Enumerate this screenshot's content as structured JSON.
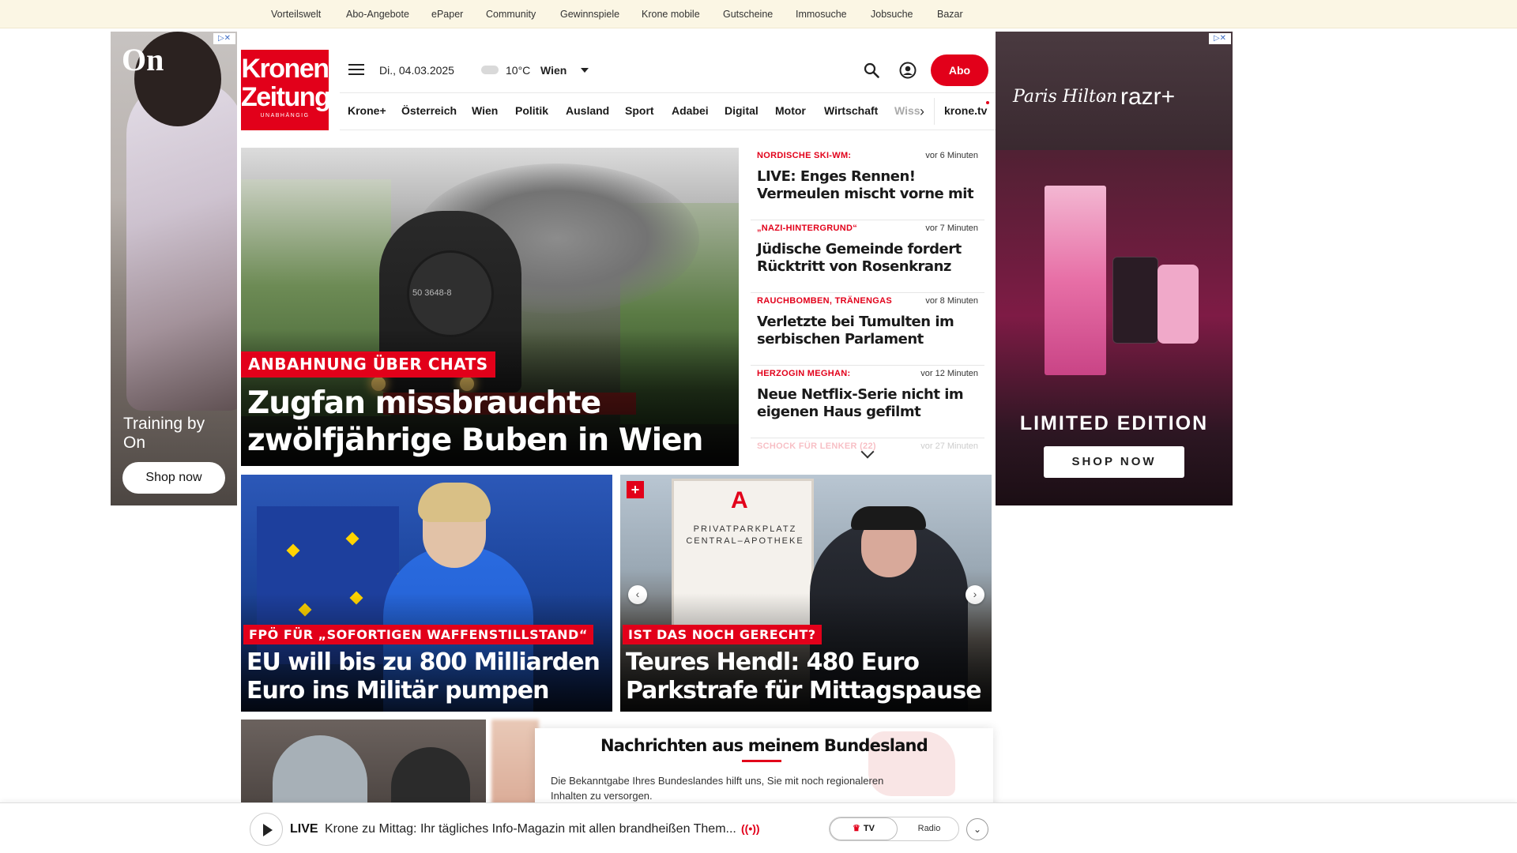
{
  "topbar": {
    "links": [
      "Vorteilswelt",
      "Abo-Angebote",
      "ePaper",
      "Community",
      "Gewinnspiele",
      "Krone mobile",
      "Gutscheine",
      "Immosuche",
      "Jobsuche",
      "Bazar"
    ]
  },
  "ads": {
    "left": {
      "brand": "On",
      "tagline": "Training by On",
      "cta": "Shop now",
      "adchoice": "▷✕"
    },
    "right": {
      "signature": "Paris Hilton",
      "x": "×",
      "brand": "razr+",
      "headline": "LIMITED EDITION",
      "cta": "SHOP NOW",
      "adchoice": "▷✕"
    }
  },
  "logo": {
    "line1": "Kronen",
    "line2": "Zeitung",
    "line3": "UNABHÄNGIG"
  },
  "header": {
    "date": "Di., 04.03.2025",
    "temperature": "10°C",
    "city": "Wien",
    "abo_label": "Abo"
  },
  "nav": {
    "items": [
      "Krone+",
      "Österreich",
      "Wien",
      "Politik",
      "Ausland",
      "Sport",
      "Adabei",
      "Digital",
      "Motor",
      "Wirtschaft",
      "Wiss"
    ],
    "tv_link": "krone.tv",
    "arrow": "›"
  },
  "hero": {
    "kicker": "ANBAHNUNG ÜBER CHATS",
    "headline": "Zugfan missbrauchte zwölfjährige Buben in Wien",
    "loco_number": "50 3648-8"
  },
  "ticker": [
    {
      "tag": "NORDISCHE SKI-WM:",
      "time": "vor 6 Minuten",
      "title": "LIVE: Enges Rennen! Vermeulen mischt vorne mit"
    },
    {
      "tag": "„NAZI-HINTERGRUND“",
      "time": "vor 7 Minuten",
      "title": "Jüdische Gemeinde fordert Rücktritt von Rosenkranz"
    },
    {
      "tag": "RAUCHBOMBEN, TRÄNENGAS",
      "time": "vor 8 Minuten",
      "title": "Verletzte bei Tumulten im serbischen Parlament"
    },
    {
      "tag": "HERZOGIN MEGHAN:",
      "time": "vor 12 Minuten",
      "title": "Neue Netflix-Serie nicht im eigenen Haus gefilmt"
    },
    {
      "tag": "SCHOCK FÜR LENKER (22)",
      "time": "vor 27 Minuten",
      "title": ""
    }
  ],
  "cards": [
    {
      "kicker": "FPÖ FÜR „SOFORTIGEN WAFFENSTILLSTAND“",
      "headline": "EU will bis zu 800 Milliarden Euro ins Militär pumpen"
    },
    {
      "kicker": "IST DAS NOCH GERECHT?",
      "headline": "Teures Hendl: 480 Euro Parkstrafe für Mittagspause",
      "plus": "+",
      "sign_line1": "PRIVATPARKPLATZ",
      "sign_line2": "CENTRAL–APOTHEKE",
      "sign_logo": "A",
      "prev": "‹",
      "next": "›"
    }
  ],
  "region": {
    "title": "Nachrichten aus meinem Bundesland",
    "text": "Die Bekanntgabe Ihres Bundeslandes hilft uns, Sie mit noch regionaleren Inhalten zu versorgen."
  },
  "player": {
    "live": "LIVE",
    "show": "Krone zu Mittag: Ihr tägliches Info-Magazin mit allen brandheißen Them...",
    "wave": "((•))",
    "tv_label": "TV",
    "tv_crown": "♛",
    "radio_label": "Radio",
    "more": "⌄"
  },
  "colors": {
    "brand_red": "#e2001a",
    "topbar_bg": "#fbf6e4"
  }
}
